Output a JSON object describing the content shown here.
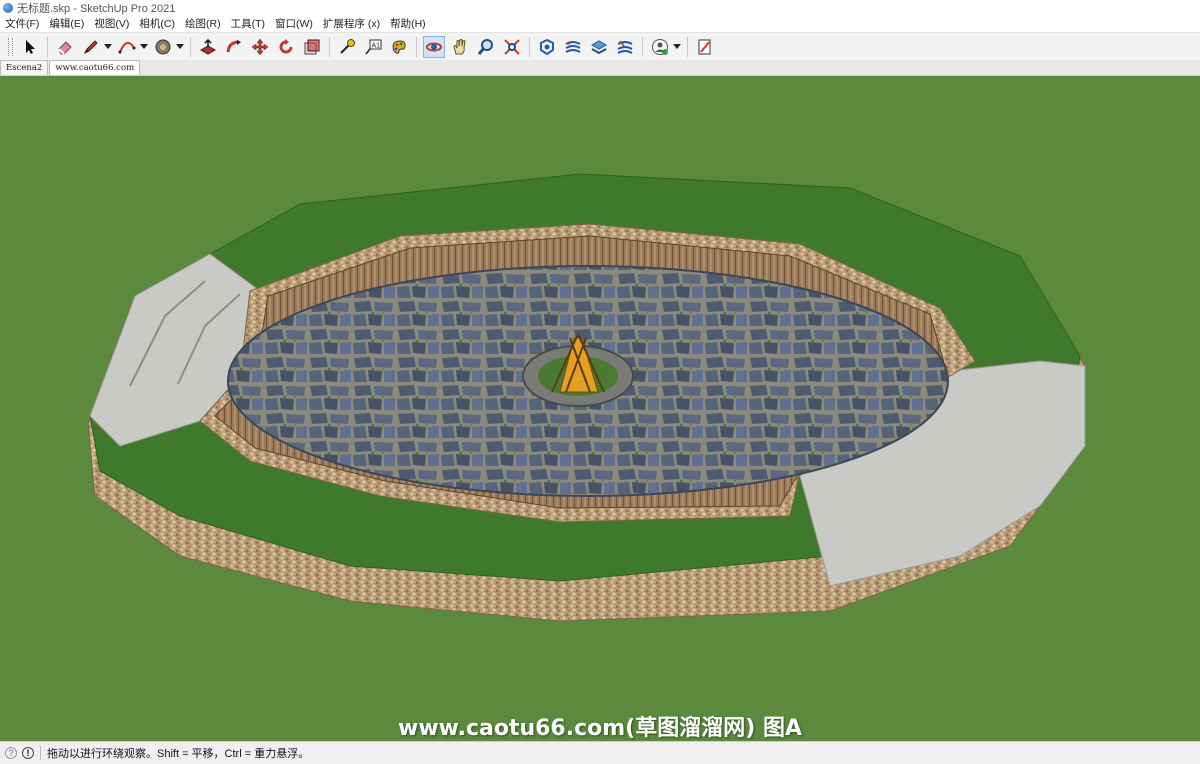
{
  "window": {
    "title": "无标题.skp - SketchUp Pro 2021"
  },
  "menu": [
    "文件(F)",
    "编辑(E)",
    "视图(V)",
    "相机(C)",
    "绘图(R)",
    "工具(T)",
    "窗口(W)",
    "扩展程序 (x)",
    "帮助(H)"
  ],
  "toolbar": {
    "tools": [
      {
        "name": "select-tool",
        "icon": "arrow-icon"
      },
      {
        "name": "eraser-tool",
        "icon": "eraser-icon"
      },
      {
        "name": "line-tool",
        "icon": "pencil-icon",
        "dropdown": true
      },
      {
        "name": "arc-tool",
        "icon": "arc-icon",
        "dropdown": true
      },
      {
        "name": "paint-bucket-tool",
        "icon": "paint-icon",
        "dropdown": true
      },
      {
        "name": "push-pull-tool",
        "icon": "push-pull-icon"
      },
      {
        "name": "follow-me-tool",
        "icon": "follow-me-icon"
      },
      {
        "name": "move-tool",
        "icon": "move-icon"
      },
      {
        "name": "rotate-tool",
        "icon": "rotate-icon"
      },
      {
        "name": "scale-tool",
        "icon": "scale-icon"
      },
      {
        "name": "tape-measure-tool",
        "icon": "tape-icon"
      },
      {
        "name": "text-tool",
        "icon": "text-icon"
      },
      {
        "name": "paint-tool",
        "icon": "palette-icon"
      },
      {
        "name": "orbit-tool",
        "icon": "orbit-icon",
        "active": true
      },
      {
        "name": "pan-tool",
        "icon": "hand-icon"
      },
      {
        "name": "zoom-tool",
        "icon": "zoom-icon"
      },
      {
        "name": "zoom-extents-tool",
        "icon": "zoom-extents-icon"
      },
      {
        "name": "warehouse-tool",
        "icon": "warehouse-icon"
      },
      {
        "name": "extension-warehouse-tool",
        "icon": "layers-icon"
      },
      {
        "name": "components-tool",
        "icon": "stack-icon"
      },
      {
        "name": "sandbox-tool",
        "icon": "sandbox-icon"
      },
      {
        "name": "account-tool",
        "icon": "account-icon",
        "dropdown": true
      },
      {
        "name": "layout-tool",
        "icon": "layout-icon"
      }
    ]
  },
  "tabs": [
    {
      "label": "Escena2",
      "active": false
    },
    {
      "label": "www.caotu66.com",
      "active": true
    }
  ],
  "watermark": "www.caotu66.com(草图溜溜网) 图A",
  "status": {
    "text": "拖动以进行环绕观察。Shift = 平移，Ctrl = 重力悬浮。"
  },
  "colors": {
    "background_green": "#5b8a3d",
    "lawn_green": "#3f7a2c",
    "paving_gray": "#c9c9c6",
    "gravel_tan": "#b89a74",
    "timber_brown": "#9a7a5a",
    "stone_blue": "#4d5a70",
    "fire_orange": "#e6a020"
  }
}
